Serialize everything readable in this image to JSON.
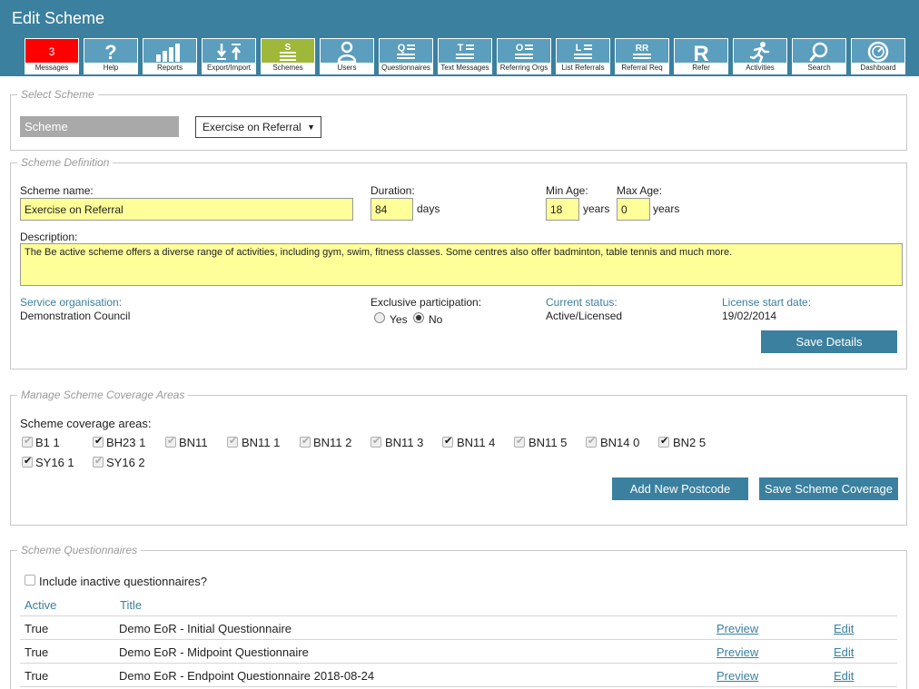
{
  "header": {
    "title": "Edit Scheme"
  },
  "toolbar": [
    {
      "label": "Messages",
      "badge": "3",
      "icon": "messages-badge"
    },
    {
      "label": "Help",
      "icon": "help-icon"
    },
    {
      "label": "Reports",
      "icon": "bar-chart-icon"
    },
    {
      "label": "Export/Import",
      "icon": "export-import-icon"
    },
    {
      "label": "Schemes",
      "icon": "schemes-icon"
    },
    {
      "label": "Users",
      "icon": "user-icon"
    },
    {
      "label": "Questionnaires",
      "icon": "questionnaire-icon"
    },
    {
      "label": "Text Messages",
      "icon": "text-messages-icon"
    },
    {
      "label": "Referring Orgs",
      "icon": "referring-orgs-icon"
    },
    {
      "label": "List Referrals",
      "icon": "list-referrals-icon"
    },
    {
      "label": "Referral Req",
      "icon": "referral-req-icon"
    },
    {
      "label": "Refer",
      "icon": "refer-icon"
    },
    {
      "label": "Activities",
      "icon": "runner-icon"
    },
    {
      "label": "Search",
      "icon": "search-icon"
    },
    {
      "label": "Dashboard",
      "icon": "dashboard-icon"
    }
  ],
  "select_scheme": {
    "legend": "Select Scheme",
    "label": "Scheme",
    "selected": "Exercise on Referral"
  },
  "definition": {
    "legend": "Scheme Definition",
    "name_label": "Scheme name:",
    "name_value": "Exercise on Referral",
    "duration_label": "Duration:",
    "duration_value": "84",
    "duration_unit": "days",
    "min_age_label": "Min Age:",
    "min_age_value": "18",
    "min_age_unit": "years",
    "max_age_label": "Max Age:",
    "max_age_value": "0",
    "max_age_unit": "years",
    "description_label": "Description:",
    "description_value": "The Be active scheme offers a diverse range of activities, including gym, swim, fitness classes. Some centres also offer badminton, table tennis and much more.",
    "service_org_label": "Service organisation:",
    "service_org_value": "Demonstration Council",
    "exclusive_label": "Exclusive participation:",
    "exclusive_yes": "Yes",
    "exclusive_no": "No",
    "status_label": "Current status:",
    "status_value": "Active/Licensed",
    "license_label": "License start date:",
    "license_value": "19/02/2014",
    "save_label": "Save Details"
  },
  "coverage": {
    "legend": "Manage Scheme Coverage Areas",
    "areas_label": "Scheme coverage areas:",
    "areas": [
      {
        "code": "B1 1",
        "editable": false
      },
      {
        "code": "BH23 1",
        "editable": true
      },
      {
        "code": "BN11",
        "editable": false
      },
      {
        "code": "BN11 1",
        "editable": false
      },
      {
        "code": "BN11 2",
        "editable": false
      },
      {
        "code": "BN11 3",
        "editable": false
      },
      {
        "code": "BN11 4",
        "editable": true
      },
      {
        "code": "BN11 5",
        "editable": false
      },
      {
        "code": "BN14 0",
        "editable": false
      },
      {
        "code": "BN2 5",
        "editable": true
      },
      {
        "code": "SY16 1",
        "editable": true
      },
      {
        "code": "SY16 2",
        "editable": false
      }
    ],
    "add_label": "Add New Postcode",
    "save_label": "Save Scheme Coverage"
  },
  "questionnaires": {
    "legend": "Scheme Questionnaires",
    "include_inactive_label": "Include inactive questionnaires?",
    "col_active": "Active",
    "col_title": "Title",
    "preview_label": "Preview",
    "edit_label": "Edit",
    "rows": [
      {
        "active": "True",
        "title": "Demo EoR - Initial Questionnaire"
      },
      {
        "active": "True",
        "title": "Demo EoR - Midpoint Questionnaire"
      },
      {
        "active": "True",
        "title": "Demo EoR - Endpoint Questionnaire 2018-08-24"
      }
    ]
  }
}
